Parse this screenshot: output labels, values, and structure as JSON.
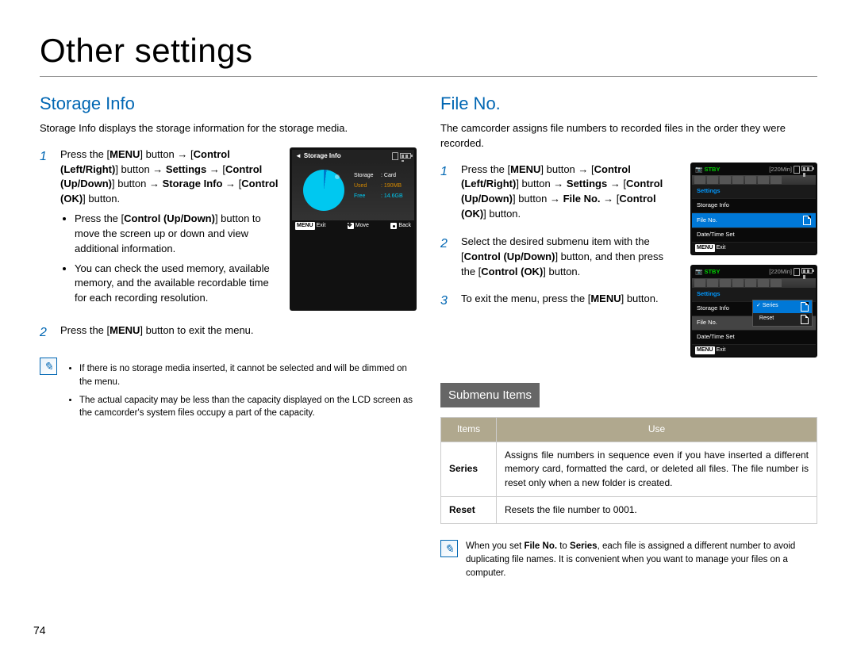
{
  "page_title": "Other settings",
  "page_number": "74",
  "left": {
    "heading": "Storage Info",
    "intro": "Storage Info displays the storage information for the storage media.",
    "step1_a": "Press the [",
    "step1_menu": "MENU",
    "step1_b": "] button → [",
    "step1_ctrl_lr": "Control (Left/Right)",
    "step1_c": "] button → ",
    "step1_settings": "Settings",
    "step1_d": " → [",
    "step1_ctrl_ud": "Control (Up/Down)",
    "step1_e": "] button → ",
    "step1_storage": "Storage Info",
    "step1_f": " → [",
    "step1_ok": "Control (OK)",
    "step1_g": "] button.",
    "bullet1_a": "Press the [",
    "bullet1_b": "Control (Up/Down)",
    "bullet1_c": "] button to move the screen up or down and view additional information.",
    "bullet2": "You can check the used memory, available memory, and the available recordable time for each recording resolution.",
    "step2_a": "Press the [",
    "step2_b": "MENU",
    "step2_c": "] button to exit the menu.",
    "note1": "If there is no storage media inserted, it cannot be selected and will be dimmed on the menu.",
    "note2": "The actual capacity may be less than the capacity displayed on the LCD screen as the camcorder's system files occupy a part of the capacity.",
    "panel": {
      "title": "Storage Info",
      "storage_label": "Storage",
      "storage_value": ": Card",
      "used_label": "Used",
      "used_value": ": 190MB",
      "free_label": "Free",
      "free_value": ": 14.6GB",
      "exit": "Exit",
      "move": "Move",
      "back": "Back",
      "menu_chip": "MENU"
    }
  },
  "right": {
    "heading": "File No.",
    "intro": "The camcorder assigns file numbers to recorded files in the order they were recorded.",
    "s1a": "Press the [",
    "s1menu": "MENU",
    "s1b": "] button → [",
    "s1lr": "Control (Left/Right)",
    "s1c": "] button → ",
    "s1set": "Settings",
    "s1d": " → [",
    "s1ud": "Control (Up/Down)",
    "s1e": "] button → ",
    "s1file": "File No.",
    "s1f": " → [",
    "s1ok": "Control (OK)",
    "s1g": "] button.",
    "s2a": "Select the desired submenu item with the [",
    "s2b": "Control (Up/Down)",
    "s2c": "] button, and then press the [",
    "s2d": "Control (OK)",
    "s2e": "] button.",
    "s3a": "To exit the menu, press the [",
    "s3b": "MENU",
    "s3c": "] button.",
    "panel": {
      "stby": "STBY",
      "time": "[220Min]",
      "settings": "Settings",
      "storage_info": "Storage Info",
      "file_no": "File No.",
      "date_time": "Date/Time Set",
      "series": "Series",
      "reset": "Reset",
      "exit": "Exit",
      "menu_chip": "MENU"
    },
    "submenu_heading": "Submenu Items",
    "table": {
      "h1": "Items",
      "h2": "Use",
      "r1_item": "Series",
      "r1_use": "Assigns file numbers in sequence even if you have inserted a different memory card, formatted the card, or deleted all files. The file number is reset only when a new folder is created.",
      "r2_item": "Reset",
      "r2_use": "Resets the file number to 0001."
    },
    "note_a": "When you set ",
    "note_b": "File No.",
    "note_c": " to ",
    "note_d": "Series",
    "note_e": ", each file is assigned a different number to avoid duplicating file names. It is convenient when you want to manage your files on a computer."
  }
}
